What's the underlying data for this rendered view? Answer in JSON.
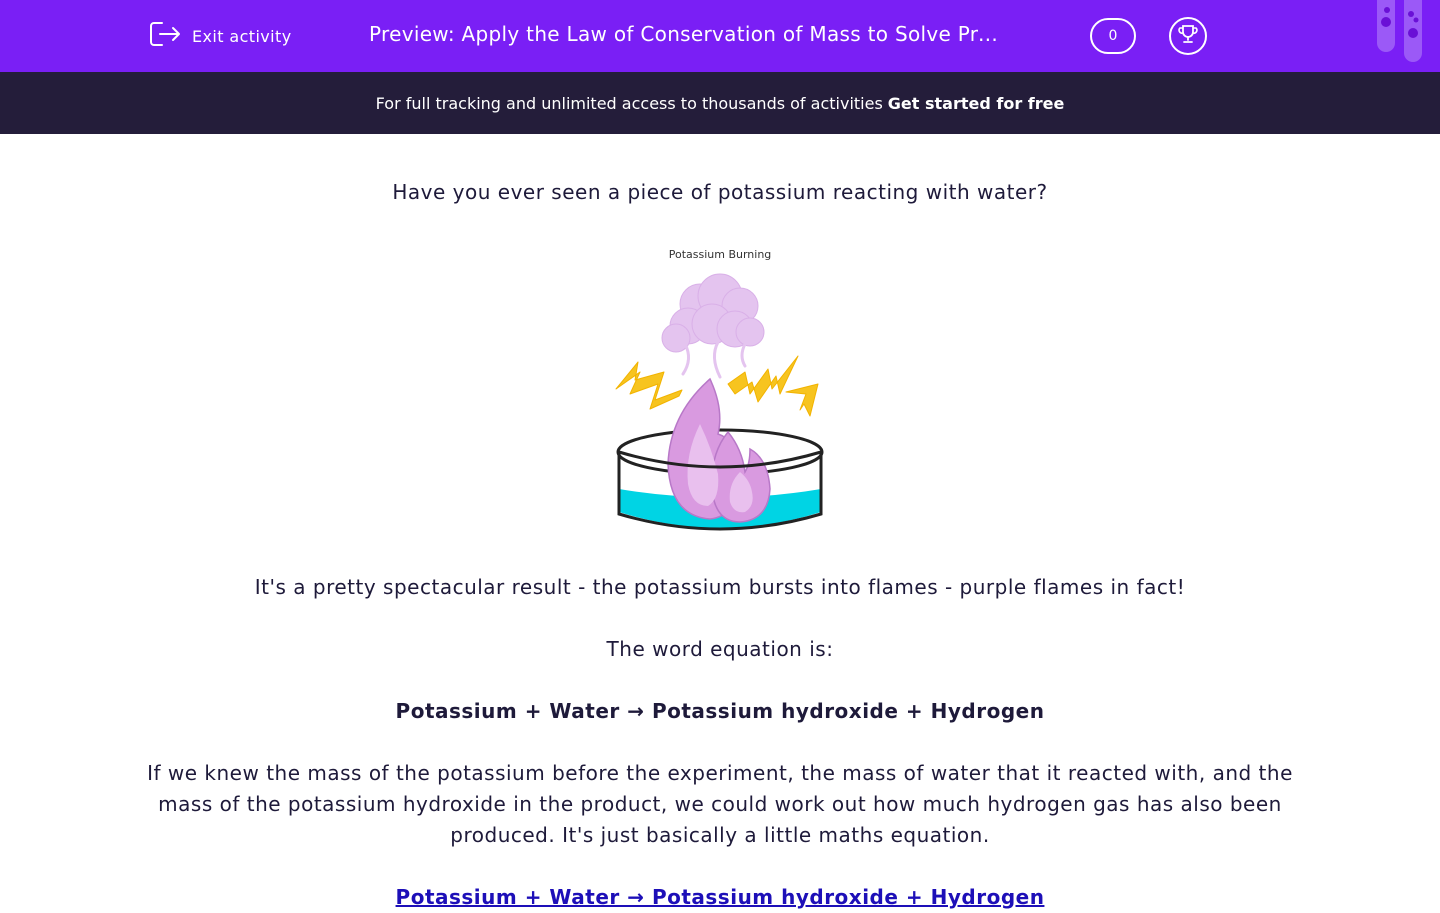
{
  "header": {
    "exit_label": "Exit activity",
    "title": "Preview: Apply the Law of Conservation of Mass to Solve Problems",
    "score": "0",
    "icons": [
      "exit-icon",
      "trophy-icon",
      "test-tubes-icon"
    ],
    "background": "#7a1ff5"
  },
  "banner": {
    "text": "For full tracking and unlimited access to thousands of activities",
    "cta": "Get started for free",
    "background": "#241d3a"
  },
  "lesson": {
    "question": "Have you ever seen a piece of potassium reacting with water?",
    "figure_caption": "Potassium Burning",
    "p1": "It's a pretty spectacular result - the potassium bursts into flames - purple flames in fact!",
    "p2": "The word equation is:",
    "equation": "Potassium + Water → Potassium hydroxide + Hydrogen",
    "p3": "If we knew the mass of the potassium before the experiment, the mass of water that it reacted with, and the mass of the potassium hydroxide in the product, we could work out how much hydrogen gas has also been produced. It's just basically a little maths equation.",
    "equation_link": "Potassium + Water → Potassium hydroxide + Hydrogen"
  }
}
